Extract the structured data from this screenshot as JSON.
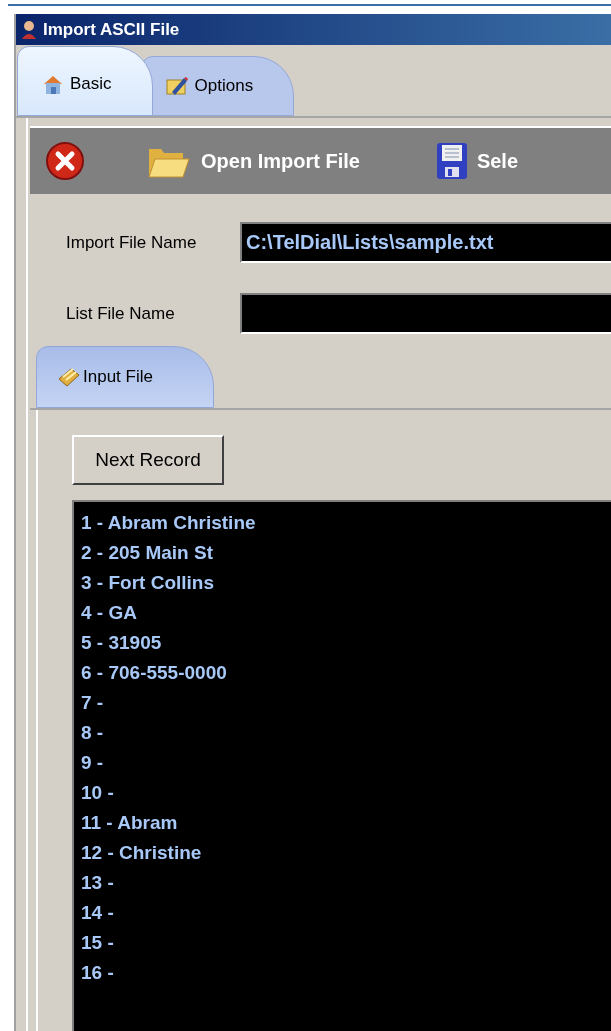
{
  "window": {
    "title": "Import ASCII File"
  },
  "tabs": [
    {
      "label": "Basic",
      "kind": "home",
      "selected": true
    },
    {
      "label": "Options",
      "kind": "edit",
      "selected": false
    }
  ],
  "toolbar": [
    {
      "kind": "close"
    },
    {
      "kind": "open",
      "label": "Open Import File"
    },
    {
      "kind": "save",
      "label": "Sele"
    }
  ],
  "fields": [
    {
      "label": "Import File Name",
      "value": "C:\\TelDial\\Lists\\sample.txt"
    },
    {
      "label": "List File Name"
    }
  ],
  "inner_tabs": [
    {
      "label": "Input File",
      "selected": true
    }
  ],
  "next_button": "Next Record",
  "records": [
    "1 - Abram Christine",
    "2 - 205 Main St",
    "3 - Fort Collins",
    "4 - GA",
    "5 - 31905",
    "6 - 706-555-0000",
    "7 -",
    "8 -",
    "9 -",
    "10 -",
    "11 - Abram",
    "12 - Christine",
    "13 -",
    "14 -",
    "15 -",
    "16 -"
  ]
}
